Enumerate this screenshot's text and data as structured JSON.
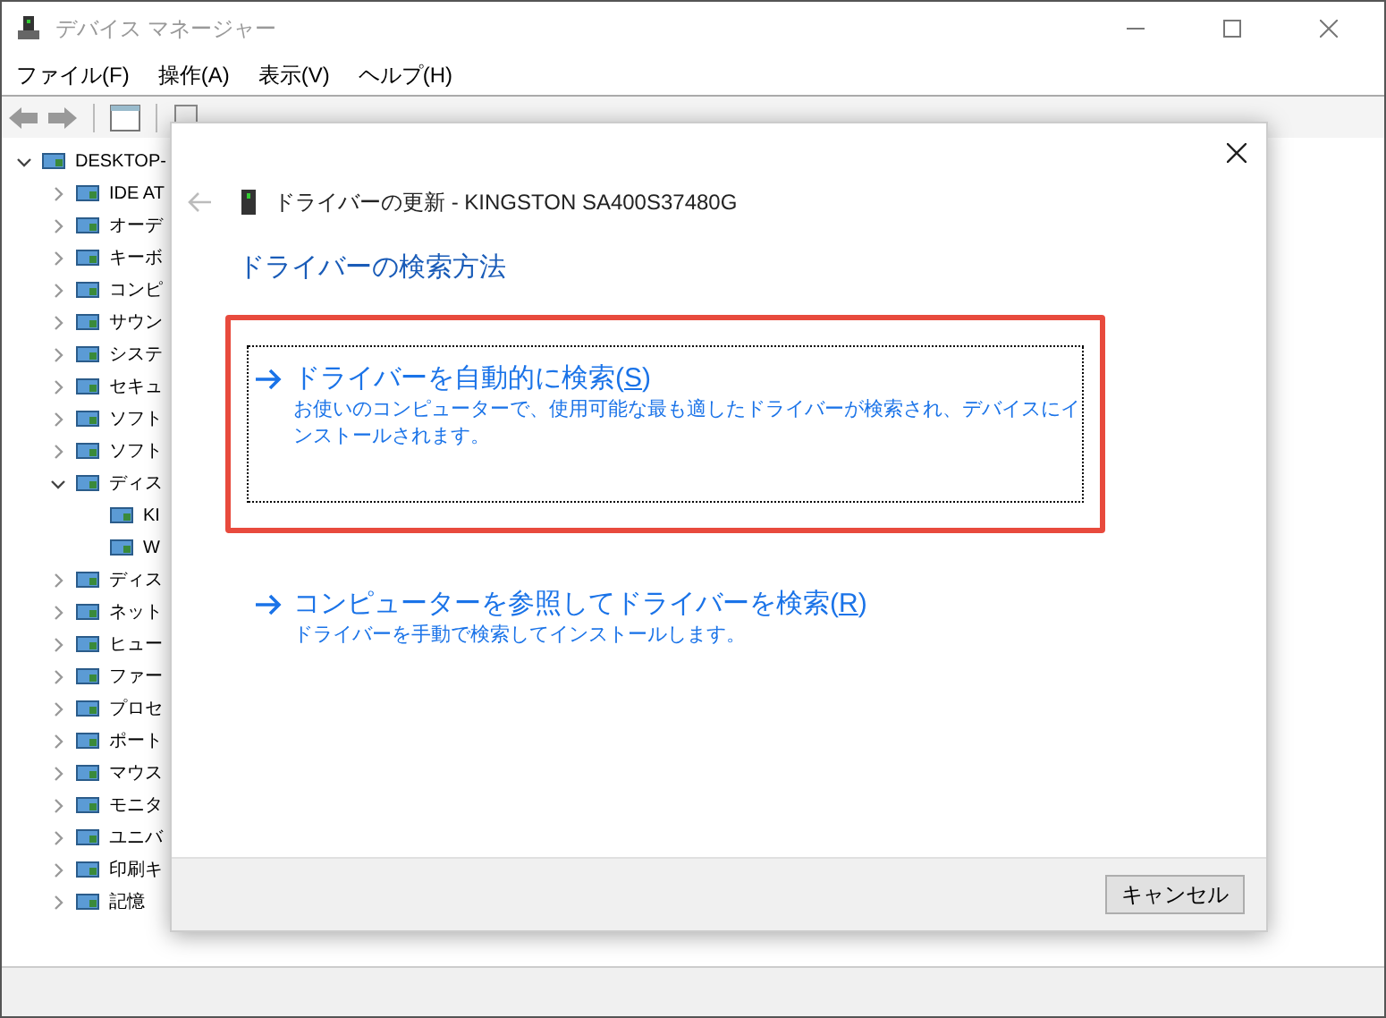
{
  "window": {
    "title": "デバイス マネージャー"
  },
  "menu": [
    "ファイル(F)",
    "操作(A)",
    "表示(V)",
    "ヘルプ(H)"
  ],
  "tree": {
    "label": "DESKTOP-",
    "expanded": true,
    "children": [
      {
        "label": "IDE AT",
        "expanded": false
      },
      {
        "label": "オーデ",
        "expanded": false
      },
      {
        "label": "キーボ",
        "expanded": false
      },
      {
        "label": "コンピ",
        "expanded": false
      },
      {
        "label": "サウン",
        "expanded": false
      },
      {
        "label": "システ",
        "expanded": false
      },
      {
        "label": "セキュ",
        "expanded": false
      },
      {
        "label": "ソフト",
        "expanded": false
      },
      {
        "label": "ソフト",
        "expanded": false
      },
      {
        "label": "ディス",
        "expanded": true,
        "children": [
          {
            "label": "KI"
          },
          {
            "label": "W"
          }
        ]
      },
      {
        "label": "ディス",
        "expanded": false
      },
      {
        "label": "ネット",
        "expanded": false
      },
      {
        "label": "ヒュー",
        "expanded": false
      },
      {
        "label": "ファー",
        "expanded": false
      },
      {
        "label": "プロセ",
        "expanded": false
      },
      {
        "label": "ポート",
        "expanded": false
      },
      {
        "label": "マウス",
        "expanded": false
      },
      {
        "label": "モニタ",
        "expanded": false
      },
      {
        "label": "ユニバ",
        "expanded": false
      },
      {
        "label": "印刷キ",
        "expanded": false
      },
      {
        "label": "記憶",
        "expanded": false
      }
    ]
  },
  "dialog": {
    "title": "ドライバーの更新 - KINGSTON SA400S37480G",
    "back_disabled": true,
    "heading": "ドライバーの検索方法",
    "options": [
      {
        "label_before": "ドライバーを自動的に検索(",
        "accesskey": "S",
        "label_after": ")",
        "description": "お使いのコンピューターで、使用可能な最も適したドライバーが検索され、デバイスにインストールされます。",
        "highlighted": true,
        "focused": true
      },
      {
        "label_before": "コンピューターを参照してドライバーを検索(",
        "accesskey": "R",
        "label_after": ")",
        "description": "ドライバーを手動で検索してインストールします。",
        "highlighted": false,
        "focused": false
      }
    ],
    "cancel": "キャンセル"
  }
}
